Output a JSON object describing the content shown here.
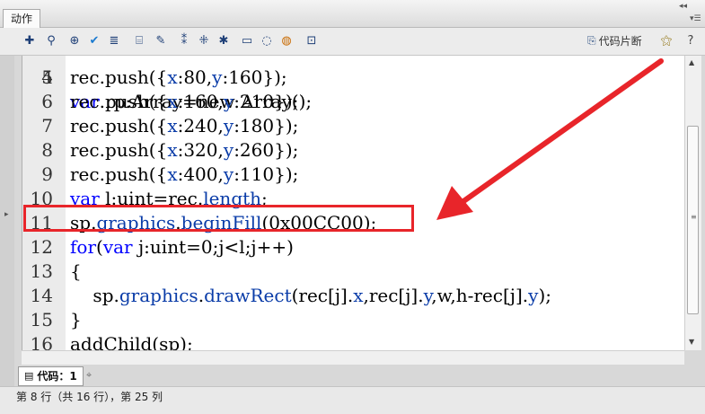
{
  "panel": {
    "title": "动作"
  },
  "toolbar": {
    "buttons": [
      "add-statement-icon",
      "find-icon",
      "target-icon",
      "check-syntax-icon",
      "auto-format-icon",
      "code-hint-icon",
      "debug-options-icon",
      "collapse-between-braces-icon",
      "collapse-selection-icon",
      "expand-all-icon",
      "apply-block-comment-icon",
      "apply-line-comment-icon",
      "remove-comment-icon",
      "show-hide-toolbox-icon"
    ],
    "snippets_label": "代码片断"
  },
  "code_lines": [
    {
      "num": "5",
      "tokens": [
        {
          "t": "rec.push({"
        },
        {
          "t": "x",
          "c": "prop"
        },
        {
          "t": ":80,"
        },
        {
          "t": "y",
          "c": "prop"
        },
        {
          "t": ":160});"
        }
      ]
    },
    {
      "num": "6",
      "tokens": [
        {
          "t": "rec.push({"
        },
        {
          "t": "x",
          "c": "prop"
        },
        {
          "t": ":160,"
        },
        {
          "t": "y",
          "c": "prop"
        },
        {
          "t": ":210});"
        }
      ]
    },
    {
      "num": "7",
      "tokens": [
        {
          "t": "rec.push({"
        },
        {
          "t": "x",
          "c": "prop"
        },
        {
          "t": ":240,"
        },
        {
          "t": "y",
          "c": "prop"
        },
        {
          "t": ":180});"
        }
      ]
    },
    {
      "num": "8",
      "tokens": [
        {
          "t": "rec.push({"
        },
        {
          "t": "x",
          "c": "prop"
        },
        {
          "t": ":320,"
        },
        {
          "t": "y",
          "c": "prop"
        },
        {
          "t": ":260});"
        }
      ]
    },
    {
      "num": "9",
      "tokens": [
        {
          "t": "rec.push({"
        },
        {
          "t": "x",
          "c": "prop"
        },
        {
          "t": ":400,"
        },
        {
          "t": "y",
          "c": "prop"
        },
        {
          "t": ":110});"
        }
      ]
    },
    {
      "num": "10",
      "tokens": [
        {
          "t": "var",
          "c": "kw"
        },
        {
          "t": " l:uint=rec."
        },
        {
          "t": "length",
          "c": "prop"
        },
        {
          "t": ";"
        }
      ]
    },
    {
      "num": "11",
      "tokens": [
        {
          "t": "sp."
        },
        {
          "t": "graphics",
          "c": "prop"
        },
        {
          "t": "."
        },
        {
          "t": "beginFill",
          "c": "prop"
        },
        {
          "t": "(0x00CC00);"
        }
      ]
    },
    {
      "num": "12",
      "tokens": [
        {
          "t": "for",
          "c": "kw"
        },
        {
          "t": "("
        },
        {
          "t": "var",
          "c": "kw"
        },
        {
          "t": " j:uint=0;j<l;j++)"
        }
      ]
    },
    {
      "num": "13",
      "tokens": [
        {
          "t": "{"
        }
      ]
    },
    {
      "num": "14",
      "tokens": [
        {
          "t": "    sp."
        },
        {
          "t": "graphics",
          "c": "prop"
        },
        {
          "t": "."
        },
        {
          "t": "drawRect",
          "c": "prop"
        },
        {
          "t": "(rec[j]."
        },
        {
          "t": "x",
          "c": "prop"
        },
        {
          "t": ",rec[j]."
        },
        {
          "t": "y",
          "c": "prop"
        },
        {
          "t": ",w,h-rec[j]."
        },
        {
          "t": "y",
          "c": "prop"
        },
        {
          "t": ");"
        }
      ]
    },
    {
      "num": "15",
      "tokens": [
        {
          "t": "}"
        }
      ]
    },
    {
      "num": "16",
      "tokens": [
        {
          "t": "addChild(sp);"
        }
      ]
    }
  ],
  "tabs": {
    "code_tab_label": "代码：1"
  },
  "status": {
    "text": "第 8 行（共 16 行），第 25 列"
  },
  "colors": {
    "highlight": "#e8252a",
    "keyword": "#0000ff",
    "property": "#0a3ca8"
  }
}
